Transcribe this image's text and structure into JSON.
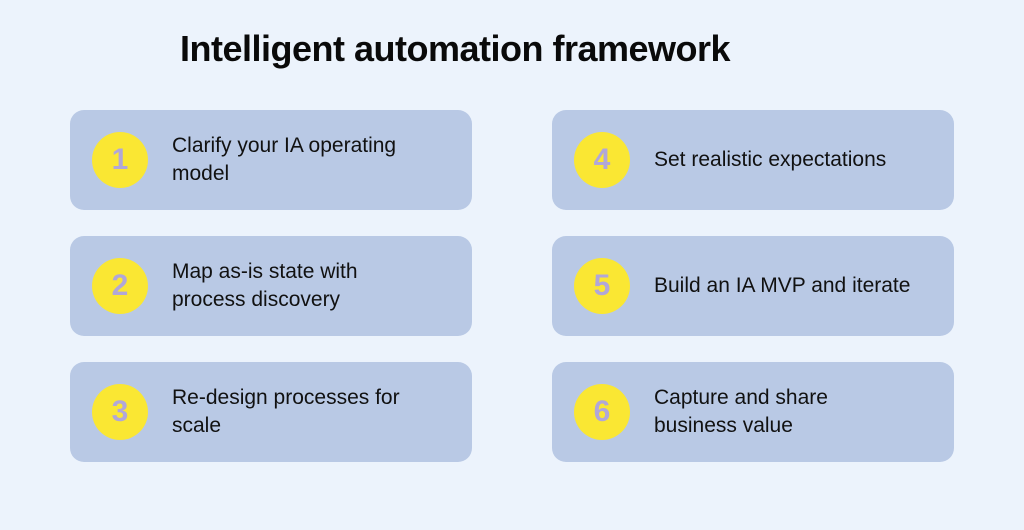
{
  "title": "Intelligent automation framework",
  "steps": [
    {
      "num": "1",
      "text": "Clarify your IA operating model"
    },
    {
      "num": "2",
      "text": "Map as-is state with process discovery"
    },
    {
      "num": "3",
      "text": "Re-design processes for scale"
    },
    {
      "num": "4",
      "text": "Set realistic expectations"
    },
    {
      "num": "5",
      "text": "Build an IA MVP and iterate"
    },
    {
      "num": "6",
      "text": "Capture and share business value"
    }
  ]
}
